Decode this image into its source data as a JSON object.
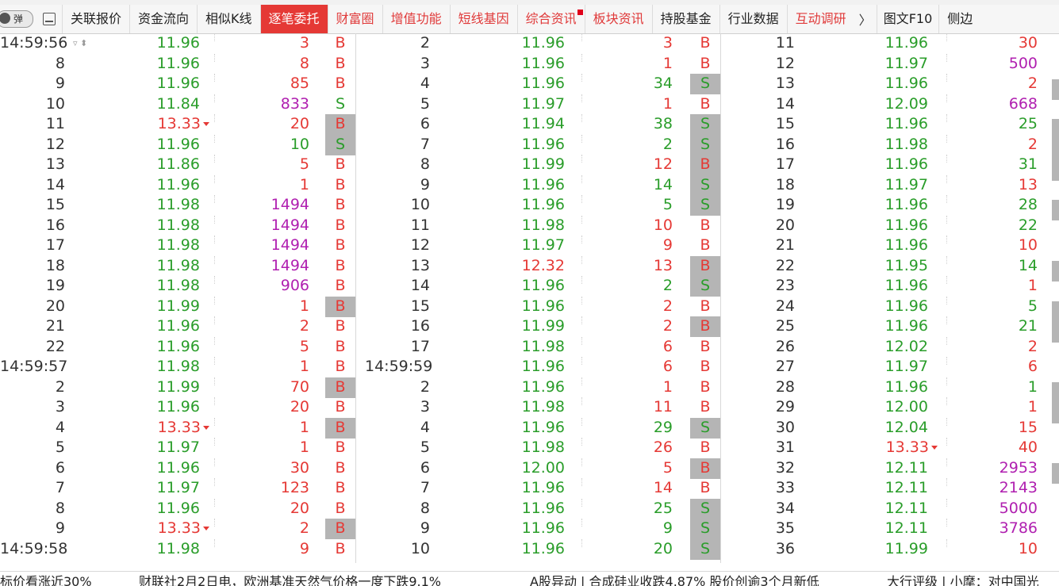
{
  "tabbar": {
    "toggle_label": "弹",
    "tabs": [
      "关联报价",
      "资金流向",
      "相似K线",
      "逐笔委托",
      "财富圈",
      "增值功能",
      "短线基因",
      "综合资讯",
      "板块资讯",
      "持股基金",
      "行业数据",
      "互动调研"
    ],
    "more_symbol": "〉",
    "extra_tabs": [
      "图文F10",
      "侧边"
    ]
  },
  "colors": {
    "buy": "#e53935",
    "sell": "#2a9d2a",
    "large": "#b01fb0",
    "highlight": "#b5b5b5",
    "active_tab": "#e53935"
  },
  "columns": [
    {
      "rows": [
        [
          "14:59:56",
          "11.96",
          "g",
          "3",
          "r",
          "B",
          false,
          false
        ],
        [
          "8",
          "11.96",
          "g",
          "8",
          "r",
          "B",
          false,
          false
        ],
        [
          "9",
          "11.96",
          "g",
          "85",
          "r",
          "B",
          false,
          false
        ],
        [
          "10",
          "11.84",
          "g",
          "833",
          "p",
          "S",
          false,
          false
        ],
        [
          "11",
          "13.33",
          "r",
          "20",
          "r",
          "B",
          true,
          true
        ],
        [
          "12",
          "11.96",
          "g",
          "10",
          "g",
          "S",
          true,
          false
        ],
        [
          "13",
          "11.86",
          "g",
          "5",
          "r",
          "B",
          false,
          false
        ],
        [
          "14",
          "11.96",
          "g",
          "1",
          "r",
          "B",
          false,
          false
        ],
        [
          "15",
          "11.98",
          "g",
          "1494",
          "p",
          "B",
          false,
          false
        ],
        [
          "16",
          "11.98",
          "g",
          "1494",
          "p",
          "B",
          false,
          false
        ],
        [
          "17",
          "11.98",
          "g",
          "1494",
          "p",
          "B",
          false,
          false
        ],
        [
          "18",
          "11.98",
          "g",
          "1494",
          "p",
          "B",
          false,
          false
        ],
        [
          "19",
          "11.98",
          "g",
          "906",
          "p",
          "B",
          false,
          false
        ],
        [
          "20",
          "11.99",
          "g",
          "1",
          "r",
          "B",
          true,
          false
        ],
        [
          "21",
          "11.96",
          "g",
          "2",
          "r",
          "B",
          false,
          false
        ],
        [
          "22",
          "11.96",
          "g",
          "5",
          "r",
          "B",
          false,
          false
        ],
        [
          "14:59:57",
          "11.98",
          "g",
          "1",
          "r",
          "B",
          false,
          false
        ],
        [
          "2",
          "11.99",
          "g",
          "70",
          "r",
          "B",
          true,
          false
        ],
        [
          "3",
          "11.96",
          "g",
          "20",
          "r",
          "B",
          false,
          false
        ],
        [
          "4",
          "13.33",
          "r",
          "1",
          "r",
          "B",
          true,
          true
        ],
        [
          "5",
          "11.97",
          "g",
          "1",
          "r",
          "B",
          false,
          false
        ],
        [
          "6",
          "11.96",
          "g",
          "30",
          "r",
          "B",
          false,
          false
        ],
        [
          "7",
          "11.97",
          "g",
          "123",
          "r",
          "B",
          false,
          false
        ],
        [
          "8",
          "11.96",
          "g",
          "20",
          "r",
          "B",
          false,
          false
        ],
        [
          "9",
          "13.33",
          "r",
          "2",
          "r",
          "B",
          true,
          true
        ],
        [
          "14:59:58",
          "11.98",
          "g",
          "9",
          "r",
          "B",
          false,
          false
        ]
      ]
    },
    {
      "rows": [
        [
          "2",
          "11.96",
          "g",
          "3",
          "r",
          "B",
          false,
          false
        ],
        [
          "3",
          "11.96",
          "g",
          "1",
          "r",
          "B",
          false,
          false
        ],
        [
          "4",
          "11.96",
          "g",
          "34",
          "g",
          "S",
          true,
          false
        ],
        [
          "5",
          "11.97",
          "g",
          "1",
          "r",
          "B",
          false,
          false
        ],
        [
          "6",
          "11.94",
          "g",
          "38",
          "g",
          "S",
          true,
          false
        ],
        [
          "7",
          "11.96",
          "g",
          "2",
          "g",
          "S",
          true,
          false
        ],
        [
          "8",
          "11.99",
          "g",
          "12",
          "r",
          "B",
          true,
          false
        ],
        [
          "9",
          "11.96",
          "g",
          "14",
          "g",
          "S",
          true,
          false
        ],
        [
          "10",
          "11.96",
          "g",
          "5",
          "g",
          "S",
          true,
          false
        ],
        [
          "11",
          "11.98",
          "g",
          "10",
          "r",
          "B",
          false,
          false
        ],
        [
          "12",
          "11.97",
          "g",
          "9",
          "r",
          "B",
          false,
          false
        ],
        [
          "13",
          "12.32",
          "r",
          "13",
          "r",
          "B",
          true,
          false
        ],
        [
          "14",
          "11.96",
          "g",
          "2",
          "g",
          "S",
          true,
          false
        ],
        [
          "15",
          "11.96",
          "g",
          "2",
          "r",
          "B",
          false,
          false
        ],
        [
          "16",
          "11.99",
          "g",
          "2",
          "r",
          "B",
          true,
          false
        ],
        [
          "17",
          "11.98",
          "g",
          "6",
          "r",
          "B",
          false,
          false
        ],
        [
          "14:59:59",
          "11.96",
          "g",
          "6",
          "r",
          "B",
          false,
          false
        ],
        [
          "2",
          "11.96",
          "g",
          "1",
          "r",
          "B",
          false,
          false
        ],
        [
          "3",
          "11.98",
          "g",
          "11",
          "r",
          "B",
          false,
          false
        ],
        [
          "4",
          "11.96",
          "g",
          "29",
          "g",
          "S",
          true,
          false
        ],
        [
          "5",
          "11.98",
          "g",
          "26",
          "r",
          "B",
          false,
          false
        ],
        [
          "6",
          "12.00",
          "g",
          "5",
          "r",
          "B",
          true,
          false
        ],
        [
          "7",
          "11.96",
          "g",
          "14",
          "r",
          "B",
          false,
          false
        ],
        [
          "8",
          "11.96",
          "g",
          "25",
          "g",
          "S",
          true,
          false
        ],
        [
          "9",
          "11.96",
          "g",
          "9",
          "g",
          "S",
          true,
          false
        ],
        [
          "10",
          "11.96",
          "g",
          "20",
          "g",
          "S",
          true,
          false
        ]
      ]
    },
    {
      "rows": [
        [
          "11",
          "11.96",
          "g",
          "30",
          "r",
          "",
          false,
          false
        ],
        [
          "12",
          "11.97",
          "g",
          "500",
          "p",
          "",
          false,
          false
        ],
        [
          "13",
          "11.96",
          "g",
          "2",
          "r",
          "",
          false,
          false
        ],
        [
          "14",
          "12.09",
          "g",
          "668",
          "p",
          "",
          false,
          false
        ],
        [
          "15",
          "11.96",
          "g",
          "25",
          "g",
          "",
          false,
          false
        ],
        [
          "16",
          "11.98",
          "g",
          "2",
          "r",
          "",
          false,
          false
        ],
        [
          "17",
          "11.96",
          "g",
          "31",
          "g",
          "",
          false,
          false
        ],
        [
          "18",
          "11.97",
          "g",
          "13",
          "r",
          "",
          false,
          false
        ],
        [
          "19",
          "11.96",
          "g",
          "28",
          "g",
          "",
          false,
          false
        ],
        [
          "20",
          "11.96",
          "g",
          "22",
          "g",
          "",
          false,
          false
        ],
        [
          "21",
          "11.96",
          "g",
          "10",
          "r",
          "",
          false,
          false
        ],
        [
          "22",
          "11.95",
          "g",
          "14",
          "g",
          "",
          false,
          false
        ],
        [
          "23",
          "11.96",
          "g",
          "1",
          "r",
          "",
          false,
          false
        ],
        [
          "24",
          "11.96",
          "g",
          "5",
          "g",
          "",
          false,
          false
        ],
        [
          "25",
          "11.96",
          "g",
          "21",
          "g",
          "",
          false,
          false
        ],
        [
          "26",
          "12.02",
          "g",
          "2",
          "r",
          "",
          false,
          false
        ],
        [
          "27",
          "11.97",
          "g",
          "6",
          "r",
          "",
          false,
          false
        ],
        [
          "28",
          "11.96",
          "g",
          "1",
          "g",
          "",
          false,
          false
        ],
        [
          "29",
          "12.00",
          "g",
          "1",
          "r",
          "",
          false,
          false
        ],
        [
          "30",
          "12.04",
          "g",
          "15",
          "r",
          "",
          false,
          false
        ],
        [
          "31",
          "13.33",
          "r",
          "40",
          "r",
          "",
          false,
          true
        ],
        [
          "32",
          "12.11",
          "g",
          "2953",
          "p",
          "",
          false,
          false
        ],
        [
          "33",
          "12.11",
          "g",
          "2143",
          "p",
          "",
          false,
          false
        ],
        [
          "34",
          "12.11",
          "g",
          "5000",
          "p",
          "",
          false,
          false
        ],
        [
          "35",
          "12.11",
          "g",
          "3786",
          "p",
          "",
          false,
          false
        ],
        [
          "36",
          "11.99",
          "g",
          "10",
          "r",
          "",
          false,
          false
        ]
      ]
    }
  ],
  "ticker": [
    "标价看涨近30%",
    "财联社2月2日电，欧洲基准天然气价格一度下跌9.1%",
    "A股异动 | 合成硅业收跌4.87% 股价创逾3个月新低",
    "大行评级 | 小摩：对中国光"
  ]
}
